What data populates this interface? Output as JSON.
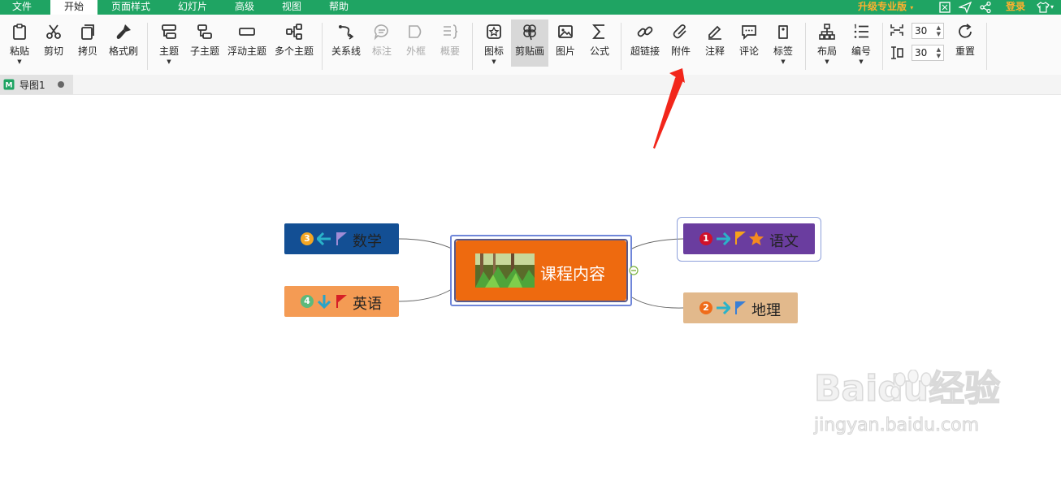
{
  "menu": {
    "tabs": [
      "文件",
      "开始",
      "页面样式",
      "幻灯片",
      "高级",
      "视图",
      "帮助"
    ],
    "active": "开始",
    "upgrade_label": "升级专业版",
    "login_label": "登录"
  },
  "toolbar": {
    "paste": "粘贴",
    "cut": "剪切",
    "copy": "拷贝",
    "format_painter": "格式刷",
    "topic": "主题",
    "subtopic": "子主题",
    "floating_topic": "浮动主题",
    "multi_topic": "多个主题",
    "relation": "关系线",
    "callout": "标注",
    "boundary": "外框",
    "summary": "概要",
    "icon": "图标",
    "clipart": "剪贴画",
    "image": "图片",
    "formula": "公式",
    "hyperlink": "超链接",
    "attachment": "附件",
    "note": "注释",
    "comment": "评论",
    "tag": "标签",
    "layout": "布局",
    "numbering": "编号",
    "spacing_h": "30",
    "spacing_v": "30",
    "reset": "重置"
  },
  "document": {
    "tab_label": "导图1"
  },
  "mindmap": {
    "central": {
      "label": "课程内容",
      "color": "#ee6a0f"
    },
    "topics": [
      {
        "label": "数学",
        "number": "3",
        "color": "#134f94",
        "badge_color": "#f4a623"
      },
      {
        "label": "英语",
        "number": "4",
        "color": "#f49b54",
        "badge_color": "#5bb97b"
      },
      {
        "label": "语文",
        "number": "1",
        "color": "#6a3d9f",
        "badge_color": "#d0112b"
      },
      {
        "label": "地理",
        "number": "2",
        "color": "#e2b98c",
        "badge_color": "#ef6c1a"
      }
    ]
  },
  "watermark": {
    "brand": "Baidu经验",
    "url": "jingyan.baidu.com"
  }
}
